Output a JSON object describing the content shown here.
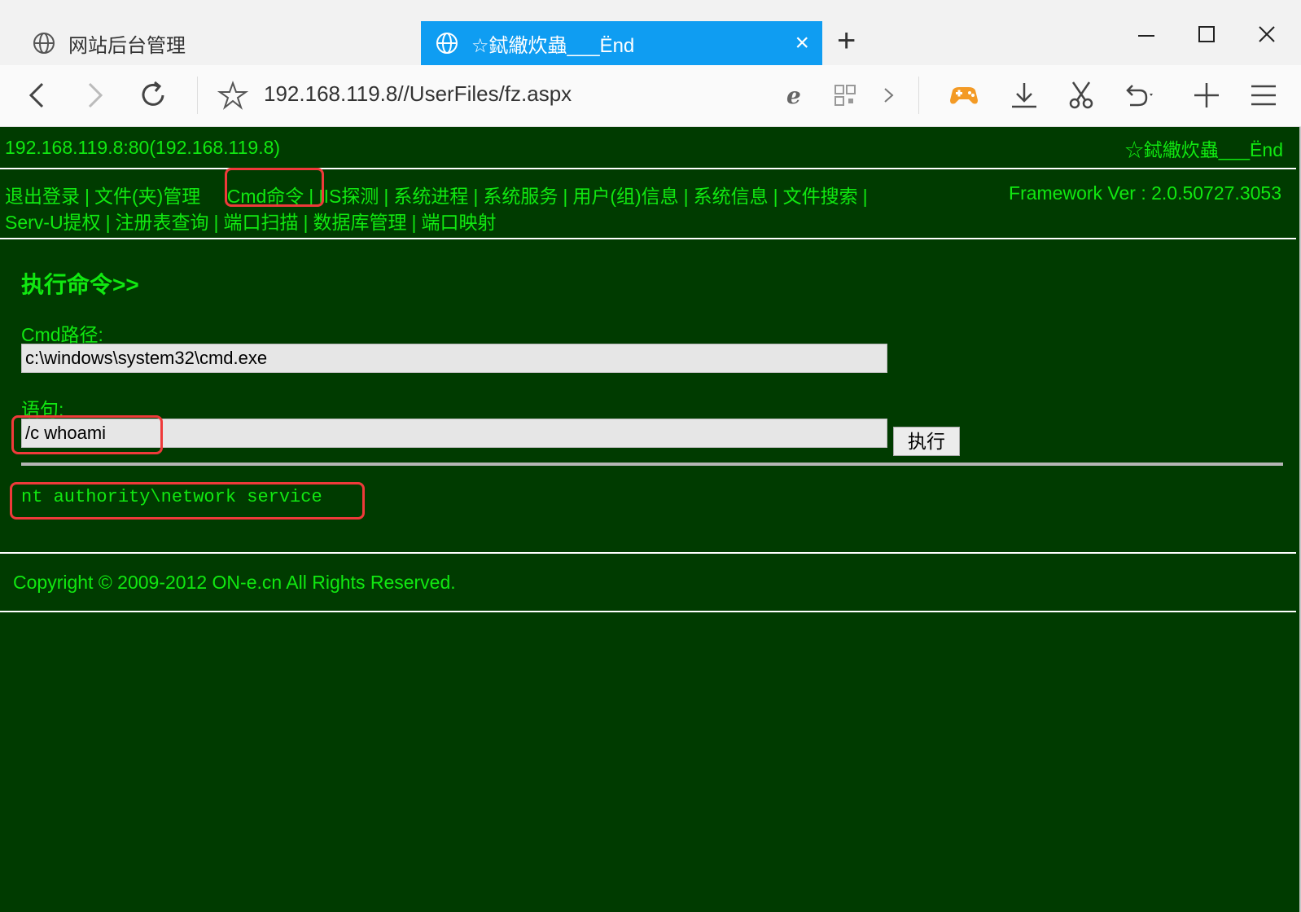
{
  "browser": {
    "tabs": [
      {
        "label": "网站后台管理"
      },
      {
        "label": "☆鋱繖炊蟲___Ënd"
      }
    ],
    "new_tab": "+",
    "window_controls": {
      "minimize": "—",
      "maximize": "☐",
      "close": "✕"
    },
    "url": "192.168.119.8//UserFiles/fz.aspx",
    "icons": [
      "back-icon",
      "forward-icon",
      "reload-icon",
      "star-icon",
      "ie-icon",
      "qr-icon",
      "chevron-right-icon",
      "gamepad-icon",
      "download-icon",
      "scissors-icon",
      "undo-icon",
      "plus-icon",
      "menu-icon"
    ]
  },
  "header": {
    "host": "192.168.119.8:80(192.168.119.8)",
    "title_right": "☆鋱繖炊蟲___Ënd"
  },
  "menu": {
    "row1": [
      "退出登录",
      "文件(夹)管理",
      "Cmd命令",
      "IIS探测",
      "系统进程",
      "系统服务",
      "用户(组)信息",
      "系统信息",
      "文件搜索"
    ],
    "row2": [
      "Serv-U提权",
      "注册表查询",
      "端口扫描",
      "数据库管理",
      "端口映射"
    ],
    "framework": "Framework Ver : 2.0.50727.3053"
  },
  "cmd": {
    "title": "执行命令>>",
    "path_label": "Cmd路径:",
    "path_value": "c:\\windows\\system32\\cmd.exe",
    "stmt_label": "语句:",
    "stmt_value": "/c whoami",
    "exec_button": "执行",
    "output": "nt authority\\network service"
  },
  "footer": {
    "copyright": "Copyright © 2009-2012 ON-e.cn All Rights Reserved."
  },
  "colors": {
    "page_bg": "#003b00",
    "text_green": "#11e811",
    "tab_active": "#0f9df2",
    "highlight": "#ef3a3a"
  }
}
